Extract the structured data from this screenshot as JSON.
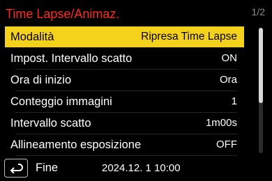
{
  "menu": {
    "title": "Time Lapse/Animaz.",
    "page_indicator": "1/2",
    "items": [
      {
        "label": "Modalità",
        "value": "Ripresa Time Lapse",
        "selected": true
      },
      {
        "label": "Impost. Intervallo scatto",
        "value": "ON"
      },
      {
        "label": "Ora di inizio",
        "value": "Ora"
      },
      {
        "label": "Conteggio immagini",
        "value": "1"
      },
      {
        "label": "Intervallo scatto",
        "value": "1m00s"
      },
      {
        "label": "Allineamento esposizione",
        "value": "OFF"
      }
    ]
  },
  "scrollbar": {
    "visible_fraction": 0.6,
    "position": 0
  },
  "footer": {
    "back_icon": "return-arrow-icon",
    "label": "Fine",
    "datetime": "2024.12. 1 10:00"
  },
  "colors": {
    "title": "#ff2a1f",
    "highlight": "#f4d21c",
    "background": "#000000",
    "text": "#ffffff"
  }
}
